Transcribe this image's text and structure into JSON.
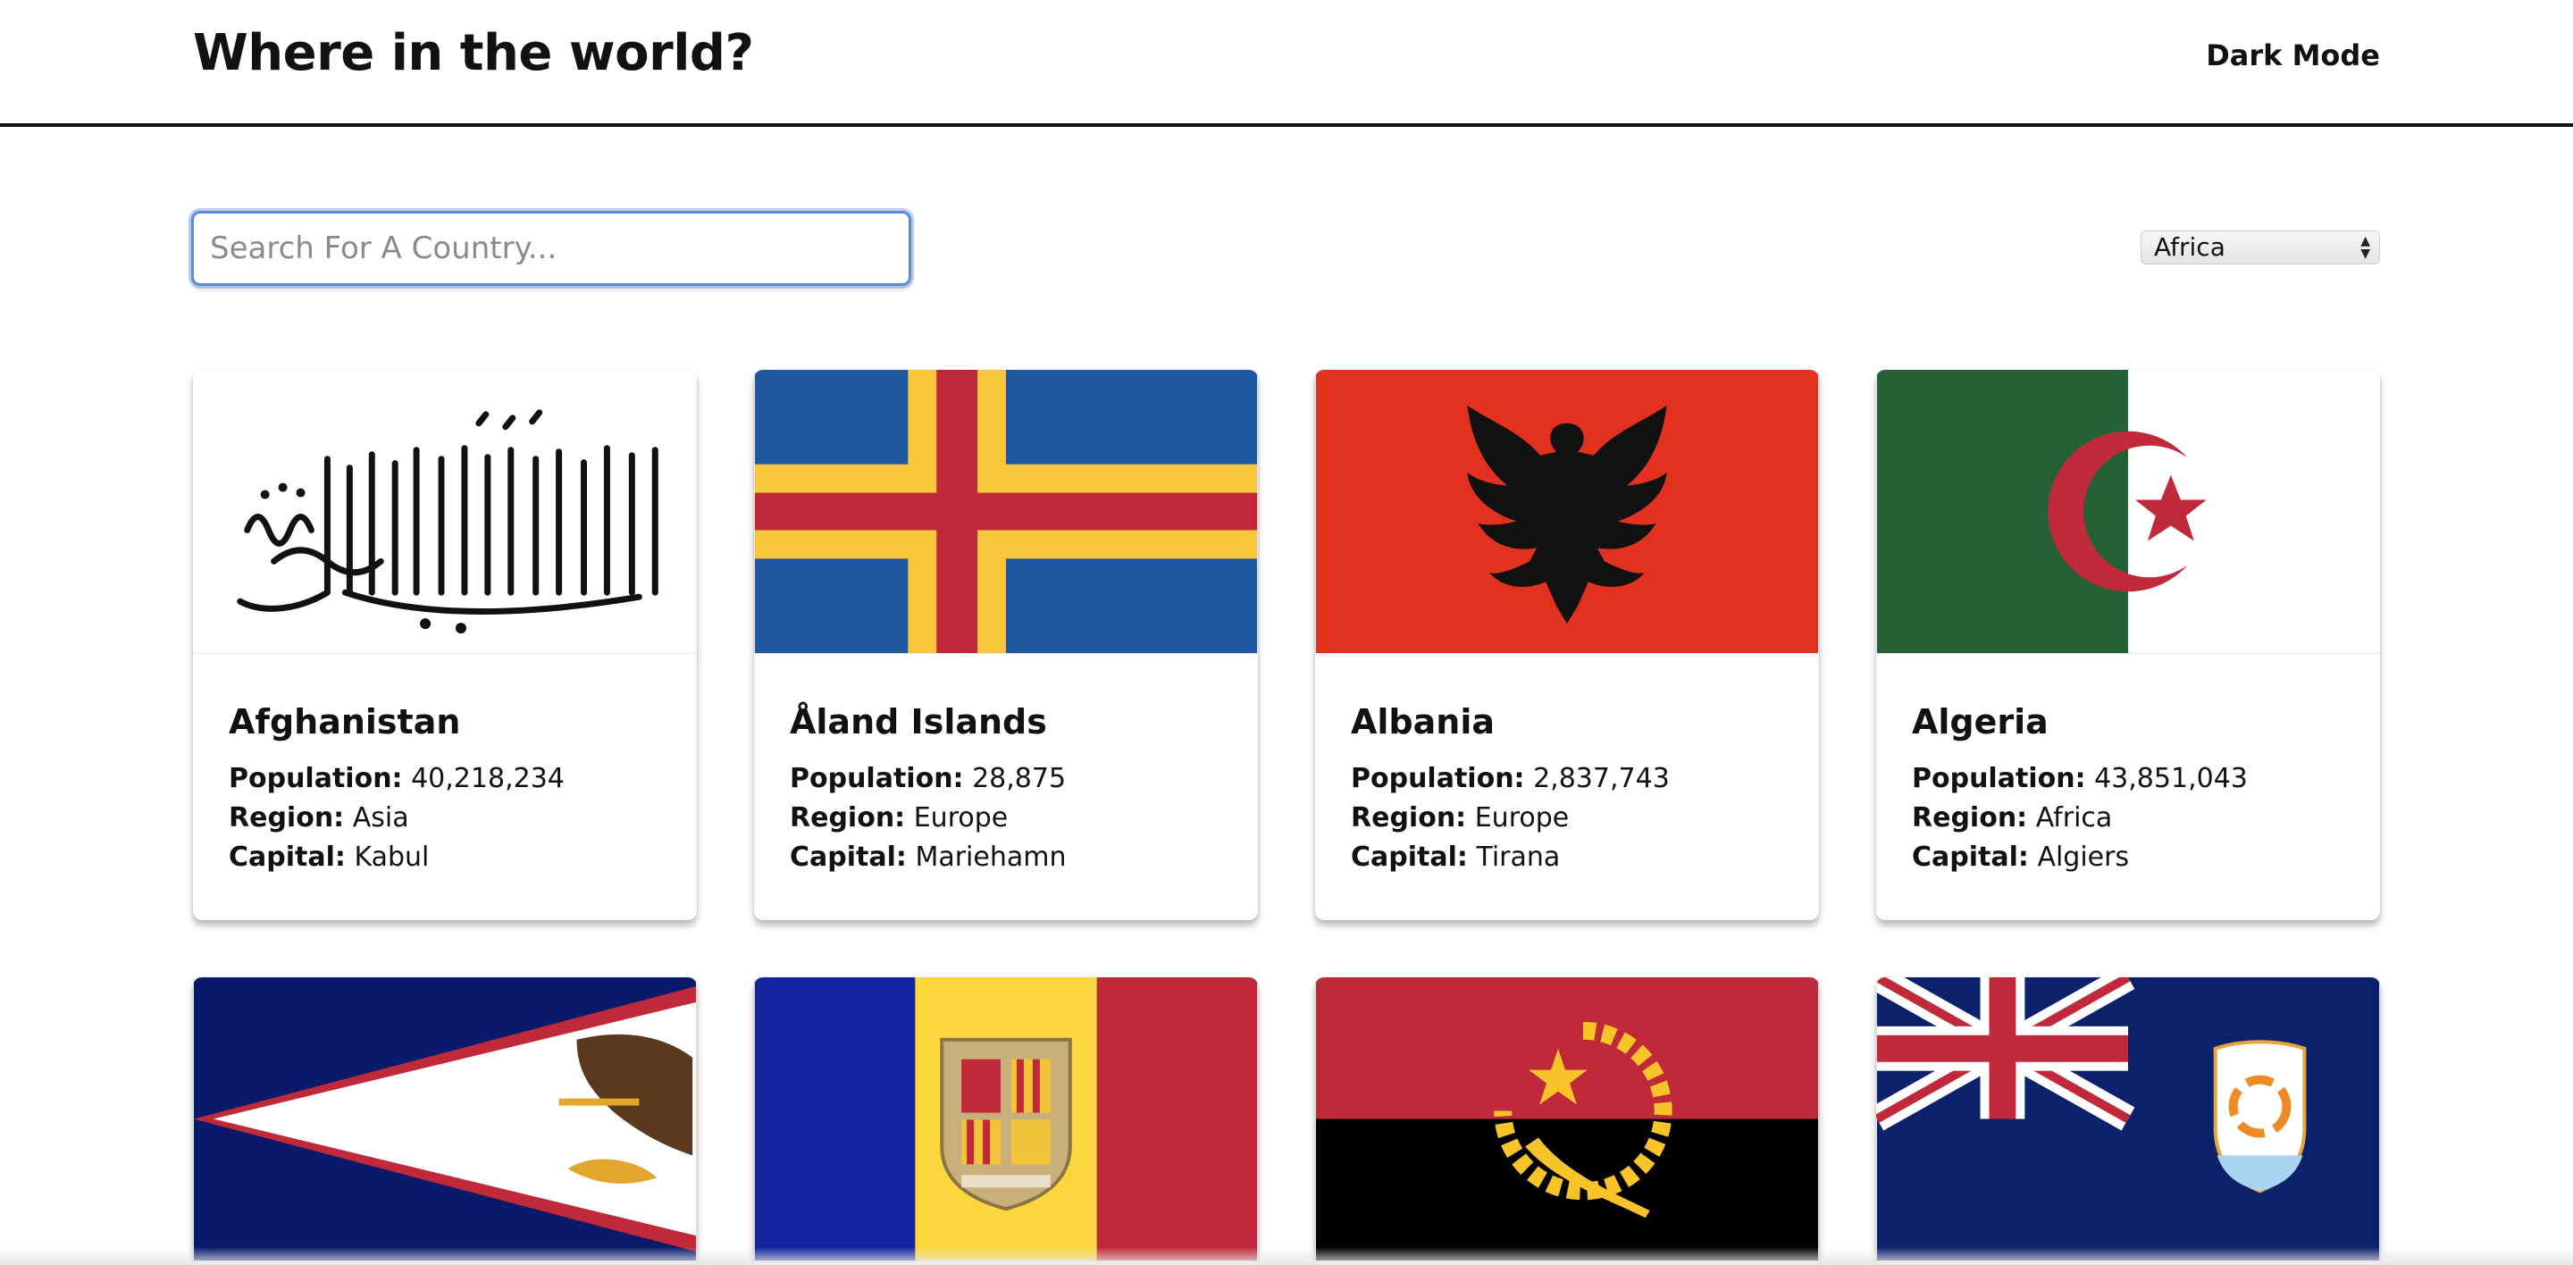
{
  "header": {
    "title": "Where in the world?",
    "dark_mode_label": "Dark Mode"
  },
  "search": {
    "placeholder": "Search For A Country...",
    "value": ""
  },
  "filter": {
    "selected": "Africa"
  },
  "labels": {
    "population": "Population:",
    "region": "Region:",
    "capital": "Capital:"
  },
  "countries": [
    {
      "name": "Afghanistan",
      "population": "40,218,234",
      "region": "Asia",
      "capital": "Kabul",
      "flag_icon": "afghanistan-flag"
    },
    {
      "name": "Åland Islands",
      "population": "28,875",
      "region": "Europe",
      "capital": "Mariehamn",
      "flag_icon": "aland-islands-flag"
    },
    {
      "name": "Albania",
      "population": "2,837,743",
      "region": "Europe",
      "capital": "Tirana",
      "flag_icon": "albania-flag"
    },
    {
      "name": "Algeria",
      "population": "43,851,043",
      "region": "Africa",
      "capital": "Algiers",
      "flag_icon": "algeria-flag"
    },
    {
      "flag_icon": "american-samoa-flag"
    },
    {
      "flag_icon": "andorra-flag"
    },
    {
      "flag_icon": "angola-flag"
    },
    {
      "flag_icon": "anguilla-flag"
    }
  ],
  "colors": {
    "search_focus": "#5b8ad9",
    "aland_blue": "#1f57a0",
    "aland_yellow": "#f8c73c",
    "red": "#c0293a",
    "albania_red": "#e2311f",
    "algeria_green": "#266036",
    "samoa_navy": "#0a1a6a",
    "andorra_blue": "#1326a0",
    "andorra_yellow": "#fbd63c",
    "anguilla_navy": "#0c216c"
  }
}
